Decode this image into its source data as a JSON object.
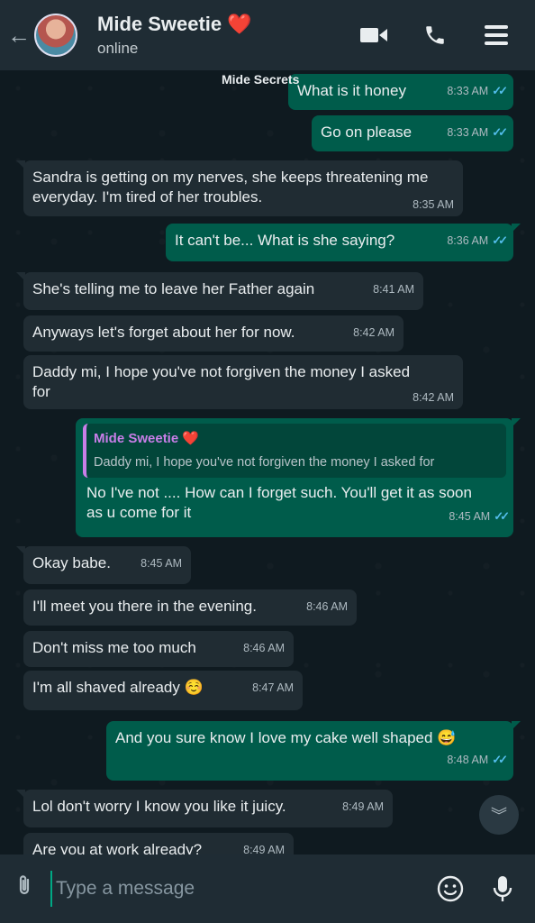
{
  "header": {
    "back_icon": "arrow-left-icon",
    "contact_name": "Mide Sweetie",
    "heart": "❤️",
    "status": "online",
    "icons": [
      "video-call-icon",
      "voice-call-icon",
      "menu-icon"
    ]
  },
  "chat": {
    "date_pill": "Mide Secrets",
    "messages": [
      {
        "dir": "out",
        "text": "What is it honey",
        "time": "8:33 AM"
      },
      {
        "dir": "out",
        "text": "Go on please",
        "time": "8:33 AM"
      },
      {
        "dir": "in",
        "text": "Sandra is getting on my nerves, she keeps threatening me everyday. I'm tired of her troubles.",
        "time": "8:35 AM"
      },
      {
        "dir": "out",
        "text": "It can't be... What is she saying?",
        "time": "8:36 AM"
      },
      {
        "dir": "in",
        "text": "She's telling me to leave her Father again",
        "time": "8:41 AM"
      },
      {
        "dir": "in",
        "text": "Anyways let's forget about her for now.",
        "time": "8:42 AM"
      },
      {
        "dir": "in",
        "text": "Daddy mi, I hope you've not forgiven the money I asked for",
        "time": "8:42 AM"
      },
      {
        "dir": "out",
        "quote_name": "Mide Sweetie ❤️",
        "quote_text": "Daddy mi, I hope you've not forgiven the money I asked for",
        "text": "No I've not .... How can I forget such. You'll get it as soon as u come for it",
        "time": "8:45 AM"
      },
      {
        "dir": "in",
        "text": "Okay babe.",
        "time": "8:45 AM"
      },
      {
        "dir": "in",
        "text": "I'll meet you there in the evening.",
        "time": "8:46 AM"
      },
      {
        "dir": "in",
        "text": "Don't miss me too much",
        "time": "8:46 AM"
      },
      {
        "dir": "in",
        "text": "I'm all shaved already ☺️",
        "time": "8:47 AM"
      },
      {
        "dir": "out",
        "text": "And you sure know I love my cake well shaped 😅",
        "time": "8:48 AM"
      },
      {
        "dir": "in",
        "text": "Lol don't worry I know you like it juicy.",
        "time": "8:49 AM"
      },
      {
        "dir": "in",
        "text": "Are you at work already?",
        "time": "8:49 AM"
      }
    ],
    "ticks": "✓✓"
  },
  "input": {
    "placeholder": "Type a message",
    "icons": [
      "attach-icon",
      "emoji-icon",
      "mic-icon"
    ]
  },
  "colors": {
    "header_bg": "#1f2c34",
    "incoming_bubble": "#202c33",
    "outgoing_bubble": "#005c4b",
    "read_ticks": "#53bdeb"
  }
}
